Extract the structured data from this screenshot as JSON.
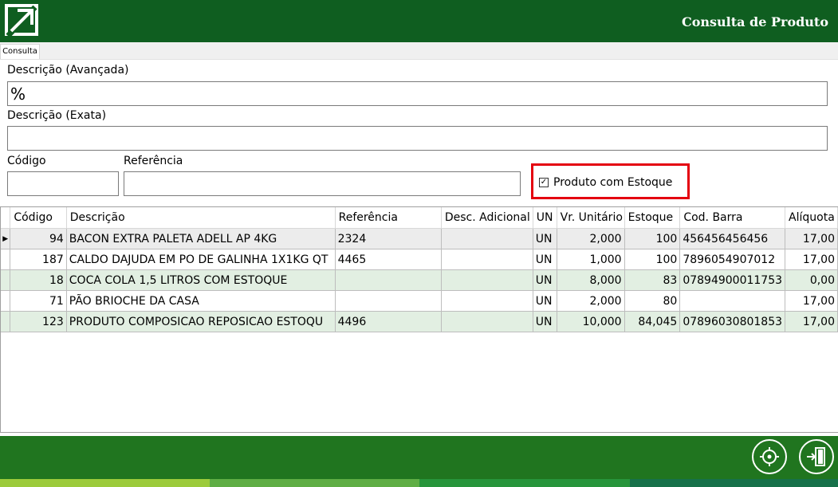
{
  "header": {
    "title": "Consulta de Produto"
  },
  "tabs": [
    {
      "label": "Consulta"
    }
  ],
  "form": {
    "desc_avancada_label": "Descrição (Avançada)",
    "desc_avancada_value": "%",
    "desc_exata_label": "Descrição (Exata)",
    "desc_exata_value": "",
    "codigo_label": "Código",
    "codigo_value": "",
    "referencia_label": "Referência",
    "referencia_value": "",
    "estoque_checkbox_label": "Produto com Estoque",
    "estoque_checkbox_checked": true
  },
  "table": {
    "columns": [
      "Código",
      "Descrição",
      "Referência",
      "Desc. Adicional",
      "UN",
      "Vr. Unitário",
      "Estoque",
      "Cod. Barra",
      "Alíquota"
    ],
    "rows": [
      [
        "94",
        "BACON EXTRA PALETA ADELL AP 4KG",
        "2324",
        "",
        "UN",
        "2,000",
        "100",
        "456456456456",
        "17,00"
      ],
      [
        "187",
        "CALDO DAJUDA EM PO DE GALINHA 1X1KG QT",
        "4465",
        "",
        "UN",
        "1,000",
        "100",
        "7896054907012",
        "17,00"
      ],
      [
        "18",
        "COCA COLA 1,5 LITROS COM ESTOQUE",
        "",
        "",
        "UN",
        "8,000",
        "83",
        "07894900011753",
        "0,00"
      ],
      [
        "71",
        "PÃO BRIOCHE DA CASA",
        "",
        "",
        "UN",
        "2,000",
        "80",
        "",
        "17,00"
      ],
      [
        "123",
        "PRODUTO COMPOSICAO REPOSICAO ESTOQU",
        "4496",
        "",
        "UN",
        "10,000",
        "84,045",
        "07896030801853",
        "17,00"
      ]
    ]
  },
  "footer": {
    "buttons": [
      {
        "icon": "crosshair-icon"
      },
      {
        "icon": "exit-door-icon"
      }
    ],
    "stripe_colors": [
      "#9ccb3b",
      "#5fae45",
      "#27953b",
      "#17714a"
    ]
  },
  "colors": {
    "header_bg": "#0f5e20",
    "footer_bg": "#20751f",
    "highlight_border": "#e4000f",
    "green_row": "#e2efe2"
  }
}
